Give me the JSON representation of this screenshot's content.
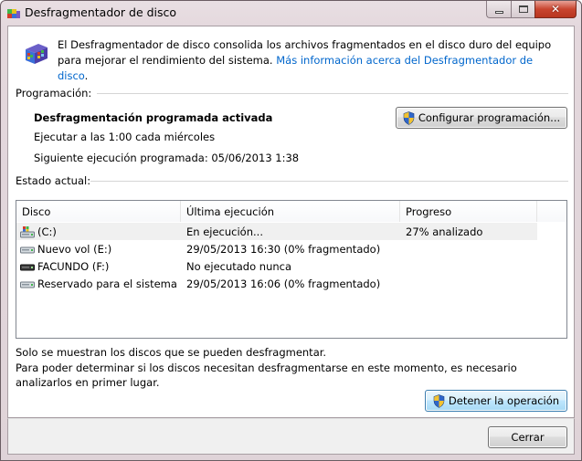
{
  "window": {
    "title": "Desfragmentador de disco",
    "close_label": "✕"
  },
  "intro": {
    "text": "El Desfragmentador de disco consolida los archivos fragmentados en el disco duro del equipo para mejorar el rendimiento del sistema. ",
    "link": "Más información acerca del Desfragmentador de disco",
    "suffix": "."
  },
  "schedule": {
    "section": "Programación:",
    "status": "Desfragmentación programada activada",
    "frequency": "Ejecutar a las 1:00 cada miércoles",
    "next_run": "Siguiente ejecución programada: 05/06/2013 1:38",
    "configure_button": "Configurar programación..."
  },
  "current": {
    "section": "Estado actual:",
    "columns": [
      "Disco",
      "Última ejecución",
      "Progreso"
    ],
    "disks": [
      {
        "name": "(C:)",
        "last_run": "En ejecución...",
        "progress": "27% analizado",
        "icon": "windows-drive-icon"
      },
      {
        "name": "Nuevo vol (E:)",
        "last_run": "29/05/2013 16:30 (0% fragmentado)",
        "progress": "",
        "icon": "hard-drive-icon"
      },
      {
        "name": "FACUNDO (F:)",
        "last_run": "No ejecutado nunca",
        "progress": "",
        "icon": "removable-drive-icon"
      },
      {
        "name": "Reservado para el sistema",
        "last_run": "29/05/2013 16:06 (0% fragmentado)",
        "progress": "",
        "icon": "hard-drive-icon"
      }
    ]
  },
  "notes": {
    "line1": "Solo se muestran los discos que se pueden desfragmentar.",
    "line2": "Para poder determinar si los discos necesitan desfragmentarse en este momento, es necesario analizarlos en primer lugar."
  },
  "actions": {
    "stop_button": "Detener la operación",
    "close_button": "Cerrar"
  }
}
